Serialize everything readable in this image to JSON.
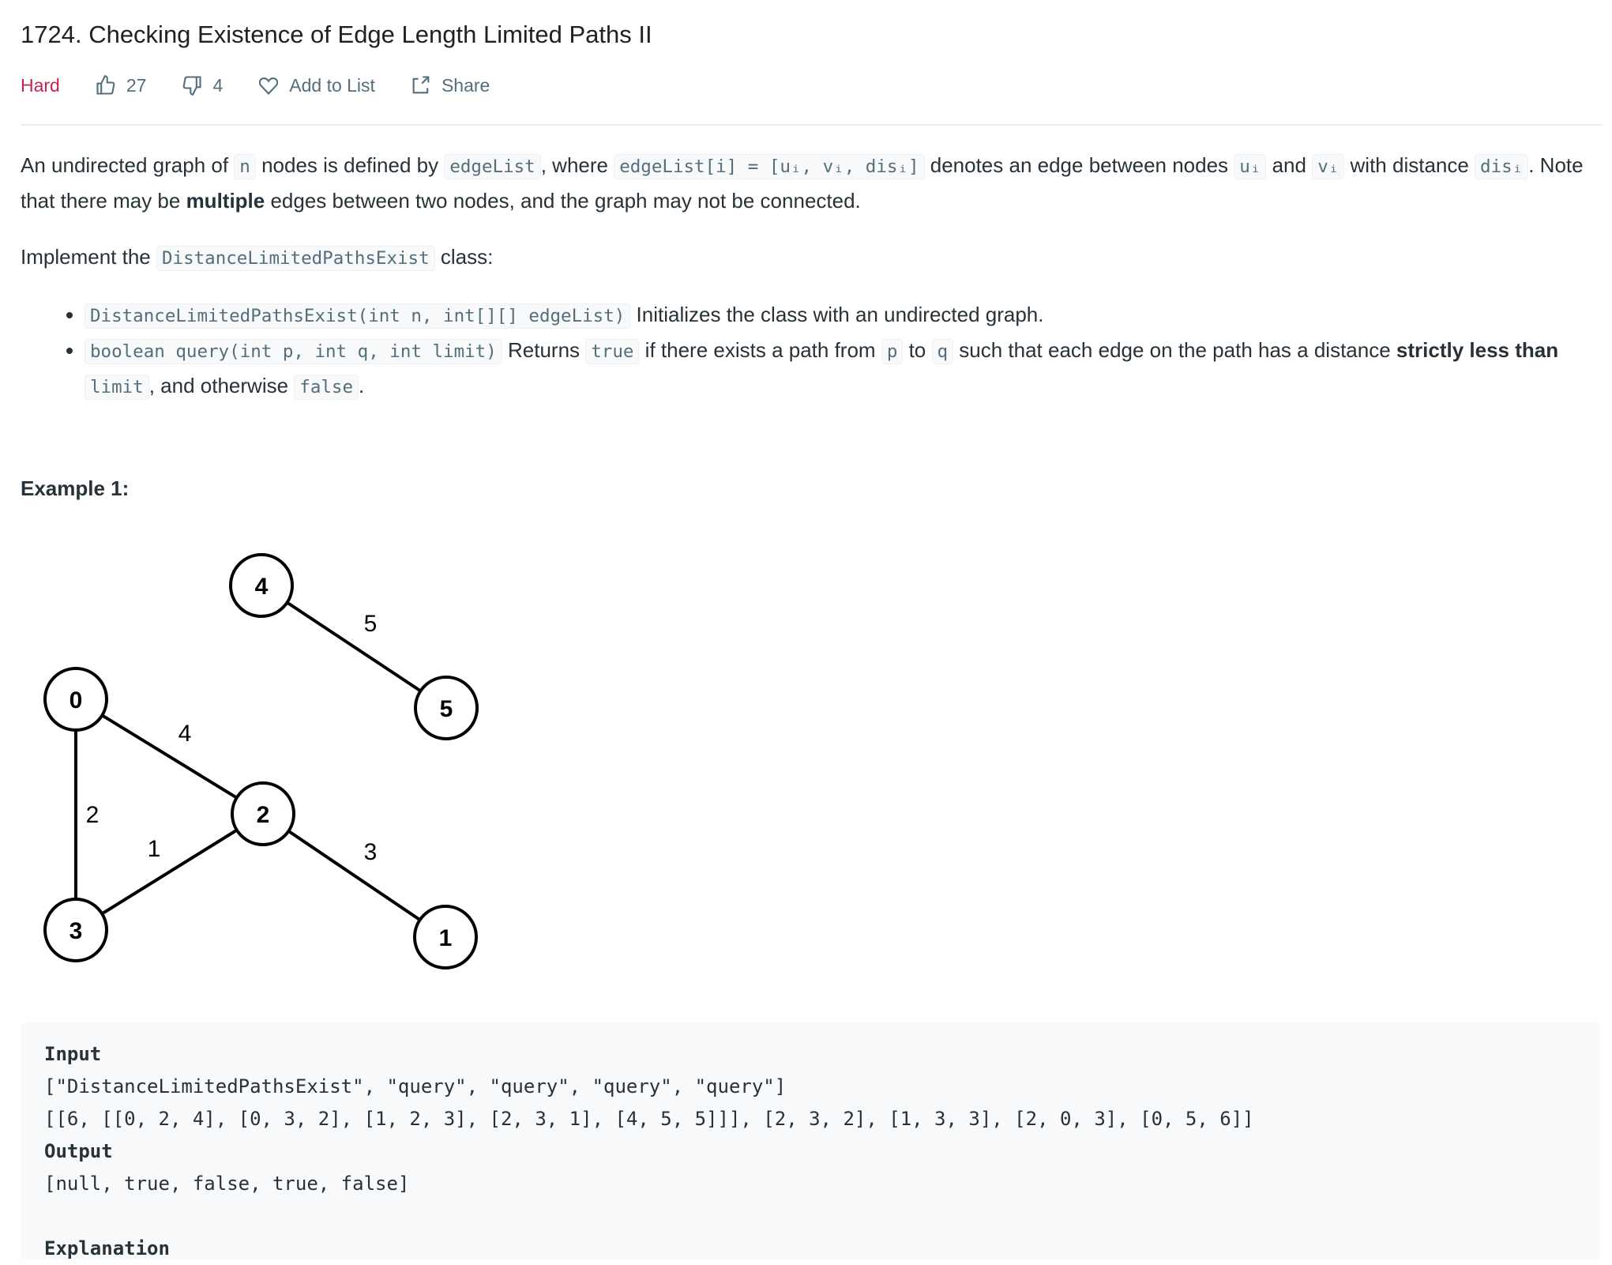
{
  "title": "1724. Checking Existence of Edge Length Limited Paths II",
  "meta": {
    "difficulty": "Hard",
    "difficulty_color": "#c7254e",
    "likes": "27",
    "dislikes": "4",
    "add_to_list": "Add to List",
    "share": "Share"
  },
  "description": {
    "p1": {
      "t1": "An undirected graph of ",
      "c1": "n",
      "t2": " nodes is defined by ",
      "c2": "edgeList",
      "t3": ", where ",
      "c3": "edgeList[i] = [uᵢ, vᵢ, disᵢ]",
      "t4": " denotes an edge between nodes ",
      "c4": "uᵢ",
      "t5": " and ",
      "c5": "vᵢ",
      "t6": " with distance ",
      "c6": "disᵢ",
      "t7": ". Note that there may be ",
      "b1": "multiple",
      "t8": " edges between two nodes, and the graph may not be connected."
    },
    "p2": {
      "t1": "Implement the ",
      "c1": "DistanceLimitedPathsExist",
      "t2": " class:"
    },
    "bullets": [
      {
        "c1": "DistanceLimitedPathsExist(int n, int[][] edgeList)",
        "t1": " Initializes the class with an undirected graph."
      },
      {
        "c1": "boolean query(int p, int q, int limit)",
        "t1": " Returns ",
        "c2": "true",
        "t2": " if there exists a path from ",
        "c3": "p",
        "t3": " to ",
        "c4": "q",
        "t4": " such that each edge on the path has a distance ",
        "b1": "strictly less than",
        "c5": "limit",
        "t5": ", and otherwise ",
        "c6": "false",
        "t6": "."
      }
    ]
  },
  "example": {
    "title": "Example 1:",
    "graph": {
      "nodes": [
        "0",
        "1",
        "2",
        "3",
        "4",
        "5"
      ],
      "edges": [
        [
          0,
          2,
          4
        ],
        [
          0,
          3,
          2
        ],
        [
          1,
          2,
          3
        ],
        [
          2,
          3,
          1
        ],
        [
          4,
          5,
          5
        ]
      ]
    },
    "code": {
      "input_label": "Input",
      "input_line1": "[\"DistanceLimitedPathsExist\", \"query\", \"query\", \"query\", \"query\"]",
      "input_line2": "[[6, [[0, 2, 4], [0, 3, 2], [1, 2, 3], [2, 3, 1], [4, 5, 5]]], [2, 3, 2], [1, 3, 3], [2, 0, 3], [0, 5, 6]]",
      "output_label": "Output",
      "output_line": "[null, true, false, true, false]",
      "explanation_label": "Explanation"
    }
  }
}
